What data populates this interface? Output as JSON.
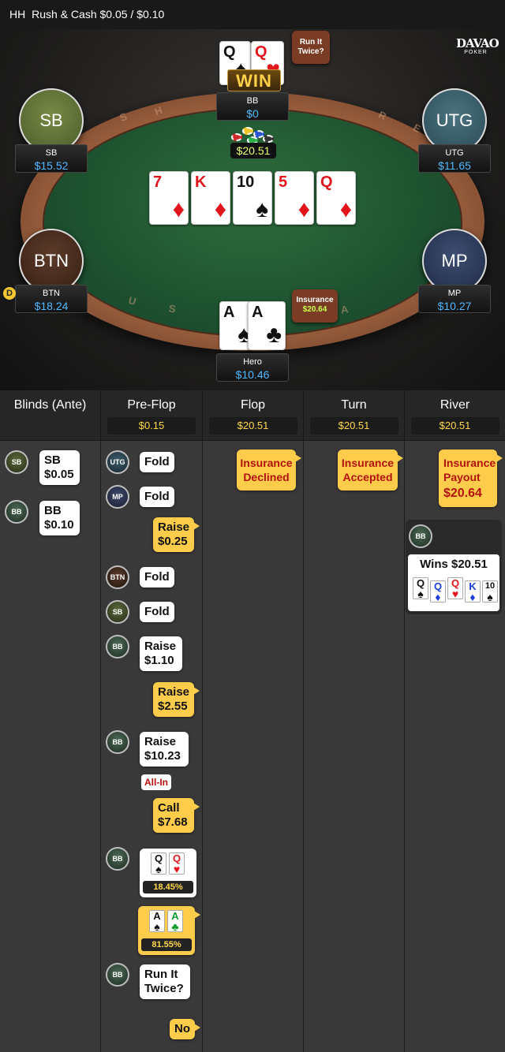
{
  "header": {
    "game": "HH",
    "title": "Rush & Cash $0.05 / $0.10"
  },
  "logo": {
    "name": "DAVAO",
    "sub": "POKER"
  },
  "table": {
    "seats": [
      {
        "pos": "SB",
        "label": "SB",
        "stack": "$15.52"
      },
      {
        "pos": "UTG",
        "label": "UTG",
        "stack": "$11.65"
      },
      {
        "pos": "BTN",
        "label": "BTN",
        "stack": "$18.24"
      },
      {
        "pos": "MP",
        "label": "MP",
        "stack": "$10.27"
      },
      {
        "pos": "BB",
        "label": "BB",
        "stack": "$0"
      },
      {
        "pos": "Hero",
        "label": "Hero",
        "stack": "$10.46"
      }
    ],
    "bb_cards": [
      {
        "rank": "Q",
        "suit": "♠"
      },
      {
        "rank": "Q",
        "suit": "♥"
      }
    ],
    "hero_cards": [
      {
        "rank": "A",
        "suit": "♠"
      },
      {
        "rank": "A",
        "suit": "♣"
      }
    ],
    "board": [
      {
        "rank": "7",
        "suit": "♦"
      },
      {
        "rank": "K",
        "suit": "♦"
      },
      {
        "rank": "10",
        "suit": "♠"
      },
      {
        "rank": "5",
        "suit": "♦"
      },
      {
        "rank": "Q",
        "suit": "♦"
      }
    ],
    "win_label": "WIN",
    "pot": "$20.51",
    "run_it_twice": "Run It Twice?",
    "insurance_label": "Insurance",
    "insurance_amount": "$20.64",
    "dealer": "D",
    "rail_text": [
      "H",
      "S",
      "R",
      "E",
      "U",
      "S",
      "A"
    ]
  },
  "history": {
    "columns": [
      {
        "title": "Blinds (Ante)",
        "pot": ""
      },
      {
        "title": "Pre-Flop",
        "pot": "$0.15"
      },
      {
        "title": "Flop",
        "pot": "$20.51"
      },
      {
        "title": "Turn",
        "pot": "$20.51"
      },
      {
        "title": "River",
        "pot": "$20.51"
      }
    ],
    "blinds": [
      {
        "player": "SB",
        "line1": "SB",
        "line2": "$0.05"
      },
      {
        "player": "BB",
        "line1": "BB",
        "line2": "$0.10"
      }
    ],
    "preflop": {
      "utg": {
        "player": "UTG",
        "action": "Fold"
      },
      "mp": {
        "player": "MP",
        "action": "Fold"
      },
      "hero_raise1": {
        "action": "Raise",
        "amount": "$0.25"
      },
      "btn": {
        "player": "BTN",
        "action": "Fold"
      },
      "sb": {
        "player": "SB",
        "action": "Fold"
      },
      "bb_raise1": {
        "player": "BB",
        "action": "Raise",
        "amount": "$1.10"
      },
      "hero_raise2": {
        "action": "Raise",
        "amount": "$2.55"
      },
      "bb_raise2": {
        "player": "BB",
        "action": "Raise",
        "amount": "$10.23"
      },
      "allin": "All-In",
      "hero_call": {
        "action": "Call",
        "amount": "$7.68"
      },
      "bb_show": {
        "player": "BB",
        "cards": [
          {
            "rank": "Q",
            "suit": "♠"
          },
          {
            "rank": "Q",
            "suit": "♥"
          }
        ],
        "equity": "18.45%"
      },
      "hero_show": {
        "cards": [
          {
            "rank": "A",
            "suit": "♠"
          },
          {
            "rank": "A",
            "suit": "♣"
          }
        ],
        "equity": "81.55%"
      },
      "bb_rit": {
        "player": "BB",
        "line1": "Run It",
        "line2": "Twice?"
      },
      "hero_no": "No"
    },
    "flop": {
      "line1": "Insurance",
      "line2": "Declined"
    },
    "turn": {
      "line1": "Insurance",
      "line2": "Accepted"
    },
    "river": {
      "line1": "Insurance",
      "line2": "Payout",
      "amount": "$20.64",
      "winner": "BB",
      "wins": "Wins $20.51",
      "cards": [
        {
          "rank": "Q",
          "suit": "♠"
        },
        {
          "rank": "Q",
          "suit": "♦"
        },
        {
          "rank": "Q",
          "suit": "♥"
        },
        {
          "rank": "K",
          "suit": "♦"
        },
        {
          "rank": "10",
          "suit": "♠"
        }
      ]
    }
  }
}
